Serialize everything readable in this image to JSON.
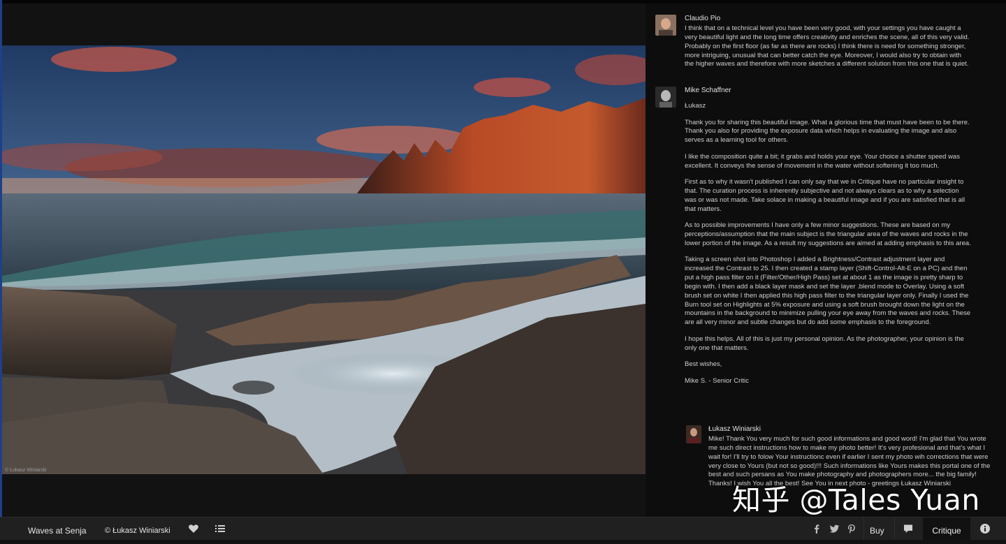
{
  "photo": {
    "title": "Waves at Senja",
    "credit_overlay": "© Łukasz Winiarski"
  },
  "bottom_bar": {
    "title": "Waves at Senja",
    "author": "© Łukasz Winiarski",
    "like_icon": "heart-icon",
    "list_icon": "list-icon",
    "share_icons": [
      "facebook-icon",
      "twitter-icon",
      "pinterest-icon"
    ],
    "buy_label": "Buy",
    "comment_icon": "comment-icon",
    "critique_label": "Critique",
    "info_icon": "info-icon"
  },
  "comments": [
    {
      "author": "Claudio Pio",
      "text": "I think that on a technical level you have been very good, with your settings you have caught a very beautiful light and the long time offers creativity and enriches the scene, all of this very valid. Probably on the first floor (as far as there are rocks) I think there is need for something stronger, more intriguing, unusual that can better catch the eye. Moreover, I would also try to obtain with the higher waves and therefore with more sketches a different solution from this one that is quiet."
    },
    {
      "author": "Mike Schaffner",
      "paragraphs": [
        "Łukasz",
        "Thank you for sharing this beautiful image. What a glorious time that must have been to be there. Thank you also for providing the exposure data which helps in evaluating the image and also serves as a learning tool for others.",
        "I like the composition quite a bit; it grabs and holds your eye. Your choice a shutter speed was excellent. It conveys the sense of movement in the water without softening it too much.",
        "First as to why it wasn't published I can only say that we in Critique have no particular insight to that. The curation process is inherently subjective and not always clears as to why a selection was or was not made. Take solace in making a beautiful image and if you are satisfied that is all that matters.",
        "As to possible improvements I have only a few minor suggestions. These are based on my perceptions/assumption that the main subject is the triangular area of the waves and rocks in the lower portion of the image. As a result my suggestions are aimed at adding emphasis to this area.",
        "Taking a screen shot into Photoshop I added a Brightness/Contrast adjustment layer and increased the Contrast to 25. I then created a stamp layer (Shift-Control-Alt-E on a PC) and then put a high pass filter on it (Filter/Other/High Pass) set at about 1 as the image is pretty sharp to begin with. I then add a black layer mask and set the layer .blend mode to Overlay. Using a soft brush set on white I then applied this high pass filter to the triangular layer only. Finally I used the Burn tool set on Highlights at 5% exposure and using a soft brush brought down the light on the mountains in the background to minimize pulling your eye away from the waves and rocks. These are all very minor and subtle changes but do add some emphasis to the foreground.",
        "I hope this helps. All of this is just my personal opinion. As the photographer, your opinion is the only one that matters.",
        "Best wishes,",
        "Mike S. - Senior Critic"
      ]
    }
  ],
  "reply": {
    "author": "Łukasz Winiarski",
    "text": "Mike! Thank You very much for such good informations and good word! I'm glad that You wrote me such direct instructions how to make my photo better! It's very profesional and that's what I wait for! I'll try to folow Your instructionc even if earlier I sent my photo wih corrections that were very close to Yours (but not so good)!!! Such informations like Yours makes this portal one of the best and such persans as You make photography and photographers more... the big family! Thanks! I wish You all the best! See You in next photo - greetings Łukasz Winiarski"
  },
  "watermark": "知乎 @Tales Yuan",
  "colors": {
    "background": "#121212",
    "panel": "#0d0d0d",
    "bar": "#202020",
    "active_tab": "#111111",
    "accent_edge": "#1d3f8c"
  }
}
